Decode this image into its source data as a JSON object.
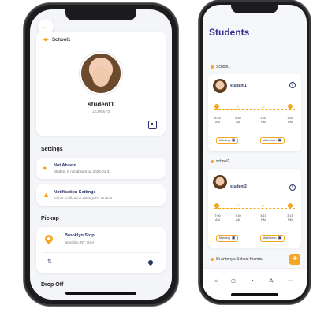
{
  "left_phone": {
    "back_icon": "arrow-left-icon",
    "school_label": "School1",
    "student_name": "student1",
    "student_id": "12345678",
    "settings_title": "Settings",
    "absence": {
      "title": "Not Absent",
      "subtitle": "Student is not absent on 2024-01-31"
    },
    "notifications": {
      "title": "Notification Settings",
      "subtitle": "Adjust notification settings for student."
    },
    "pickup_title": "Pickup",
    "pickup": {
      "title": "Brooklyn Stop",
      "subtitle": "Brooklyn, NY, USA"
    },
    "dropoff_title": "Drop Off"
  },
  "right_phone": {
    "title": "Students",
    "schools": [
      {
        "name": "School1",
        "student": "student1",
        "times": [
          "6:45\nAM",
          "9:40\nAM",
          "1:30\nPM",
          "1:50\nPM"
        ],
        "morning": "Morning",
        "afternoon": "Afternoon"
      },
      {
        "name": "school2",
        "student": "student2",
        "times": [
          "7:00\nAM",
          "7:40\nAM",
          "3:15\nPM",
          "3:15\nPM"
        ],
        "morning": "Morning",
        "afternoon": "Afternoon"
      }
    ],
    "third_school": "St Antony's School Kiambu",
    "fab_label": "+",
    "tabs": [
      "home-icon",
      "page-icon",
      "bell-icon",
      "people-icon",
      "more-icon"
    ]
  },
  "colors": {
    "accent": "#f5a623",
    "navy": "#2b3467",
    "title_purple": "#3a2e8c"
  }
}
